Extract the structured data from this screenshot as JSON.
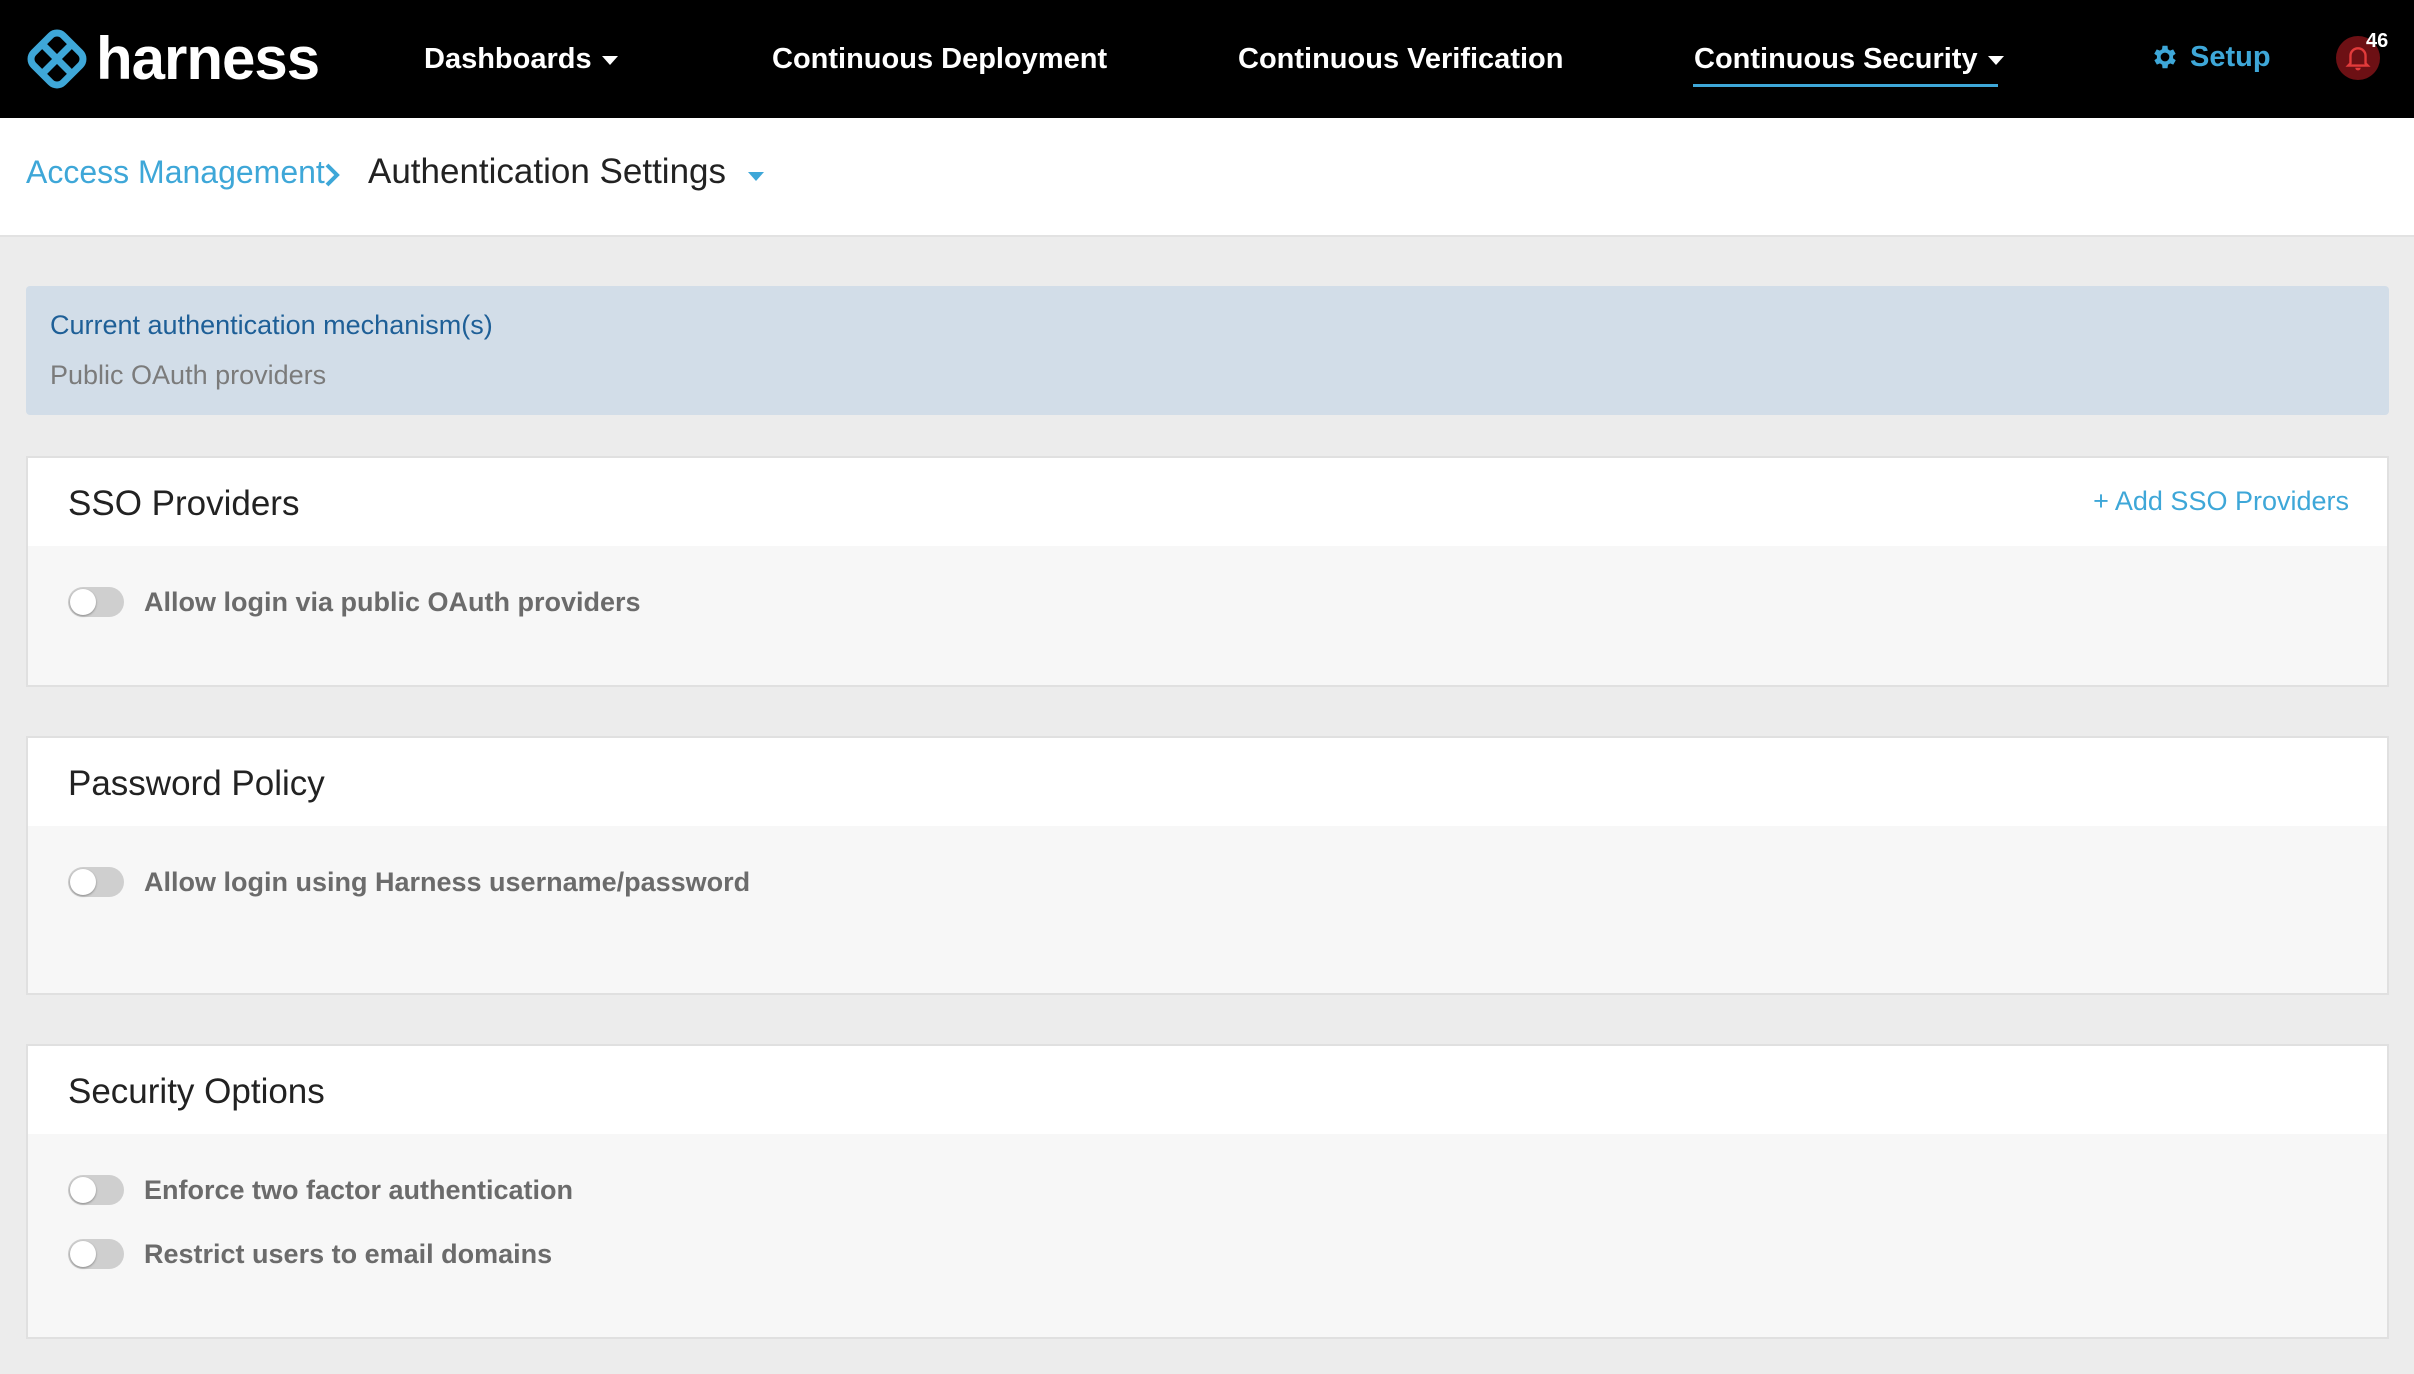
{
  "brand": {
    "name": "harness",
    "logo_icon": "harness-logo-icon",
    "accent": "#3ea7d8"
  },
  "nav": {
    "items": [
      {
        "label": "Dashboards",
        "has_dropdown": true
      },
      {
        "label": "Continuous Deployment",
        "has_dropdown": false
      },
      {
        "label": "Continuous Verification",
        "has_dropdown": false
      },
      {
        "label": "Continuous Security",
        "has_dropdown": true,
        "active": true
      }
    ],
    "setup_label": "Setup",
    "setup_icon": "gear-icon",
    "notifications_icon": "bell-icon",
    "notification_count": "46"
  },
  "breadcrumb": {
    "parent": "Access Management",
    "current": "Authentication Settings"
  },
  "auth_info": {
    "title": "Current authentication mechanism(s)",
    "value": "Public OAuth providers"
  },
  "sections": {
    "sso": {
      "title": "SSO Providers",
      "action": "+ Add SSO Providers",
      "toggles": [
        {
          "label": "Allow login via public OAuth providers",
          "on": false
        }
      ]
    },
    "password": {
      "title": "Password Policy",
      "toggles": [
        {
          "label": "Allow login using Harness username/password",
          "on": false
        }
      ]
    },
    "security": {
      "title": "Security Options",
      "toggles": [
        {
          "label": "Enforce two factor authentication",
          "on": false
        },
        {
          "label": "Restrict users to email domains",
          "on": false
        }
      ]
    }
  }
}
